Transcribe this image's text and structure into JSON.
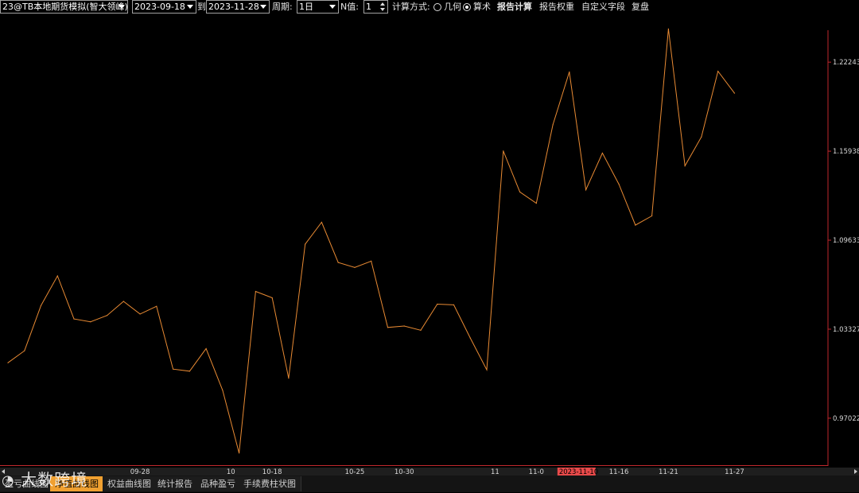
{
  "toolbar": {
    "account_value": "23@TB本地期货模拟(智大领峰)",
    "start_date": "2023-09-18",
    "to_label": "到",
    "end_date": "2023-11-28",
    "period_label": "周期:",
    "period_value": "1日",
    "n_label": "N值:",
    "n_value": "1",
    "calc_method_label": "计算方式:",
    "geometric_label": "几何",
    "arithmetic_label": "算术",
    "selected_method": "arithmetic",
    "report_calc_label": "报告计算",
    "report_weight_label": "报告权重",
    "custom_fields_label": "自定义字段",
    "replay_label": "复盘"
  },
  "chart_data": {
    "type": "line",
    "series": [
      {
        "color": "#e88a33",
        "values": [
          1.0095,
          1.018,
          1.05,
          1.071,
          1.0405,
          1.0385,
          1.043,
          1.053,
          1.044,
          1.0495,
          1.005,
          1.0035,
          1.0195,
          0.99,
          0.9455,
          1.06,
          1.0555,
          0.9985,
          1.0935,
          1.109,
          1.0805,
          1.077,
          1.0815,
          1.0345,
          1.0355,
          1.0325,
          1.051,
          1.0505,
          1.027,
          1.0045,
          1.1595,
          1.1305,
          1.1225,
          1.178,
          1.2155,
          1.132,
          1.158,
          1.136,
          1.107,
          1.1135,
          1.246,
          1.149,
          1.1695,
          1.216,
          1.2005
        ]
      }
    ],
    "y_ticks": [
      "1.22243",
      "1.15938",
      "1.09633",
      "1.03327",
      "0.97022"
    ],
    "y_tick_values": [
      1.22243,
      1.15938,
      1.09633,
      1.03327,
      0.97022
    ],
    "ylim": [
      0.9375,
      1.2535
    ],
    "x_ticks": [
      {
        "label": "09-28",
        "index": 8
      },
      {
        "label": "10",
        "index": 13.5
      },
      {
        "label": "10-18",
        "index": 16
      },
      {
        "label": "10-25",
        "index": 21
      },
      {
        "label": "10-30",
        "index": 24
      },
      {
        "label": "11",
        "index": 29.5
      },
      {
        "label": "11-0",
        "index": 32
      },
      {
        "label": "11-16",
        "index": 37
      },
      {
        "label": "11-21",
        "index": 40
      },
      {
        "label": "11-27",
        "index": 44
      }
    ],
    "crosshair_date": "2023-11-10",
    "crosshair_index": 34,
    "grid": false
  },
  "watermark": "大数跨境",
  "tabs": [
    {
      "label": "盈亏曲线图",
      "active": false
    },
    {
      "label": "净值曲线图",
      "active": true
    },
    {
      "label": "权益曲线图",
      "active": false
    },
    {
      "label": "统计报告",
      "active": false
    },
    {
      "label": "品种盈亏",
      "active": false
    },
    {
      "label": "手续费柱状图",
      "active": false
    }
  ],
  "colors": {
    "background": "#000000",
    "line": "#e88a33",
    "axis": "#c0282d",
    "active_tab": "#f0a030",
    "date_badge": "#e84a4a"
  }
}
